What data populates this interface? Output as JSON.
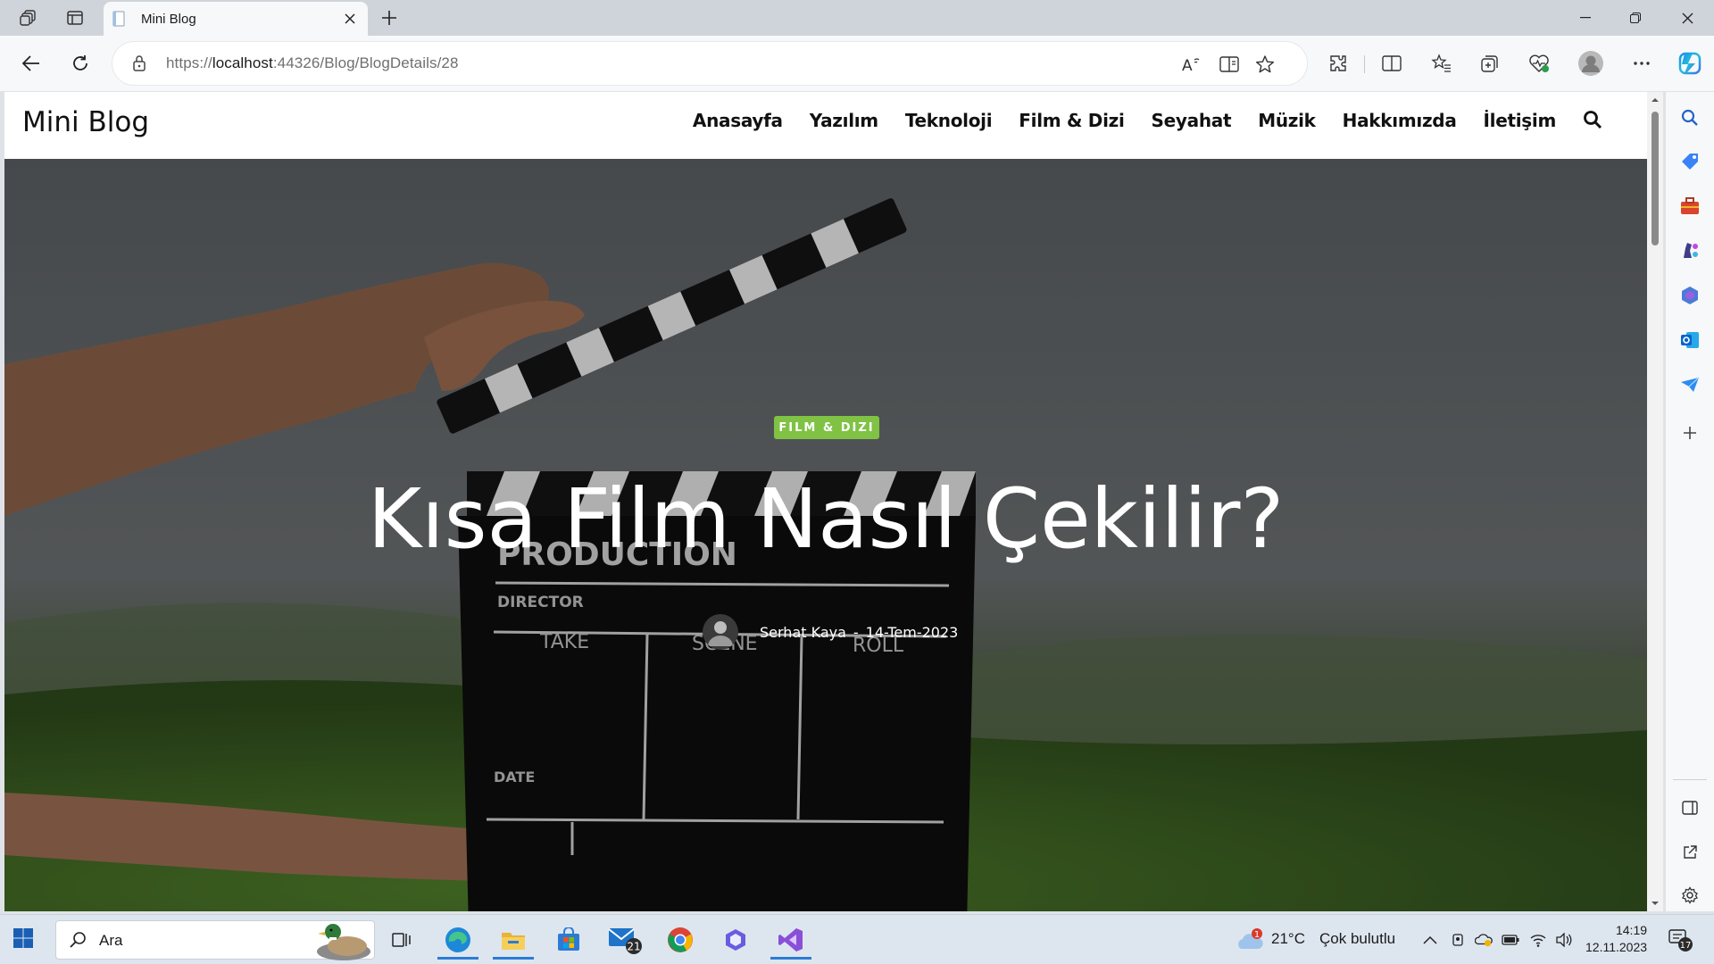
{
  "browser": {
    "tab_title": "Mini Blog",
    "url_prefix": "https://",
    "url_host": "localhost",
    "url_rest": ":44326/Blog/BlogDetails/28"
  },
  "site": {
    "brand": "Mini Blog",
    "nav": [
      "Anasayfa",
      "Yazılım",
      "Teknoloji",
      "Film & Dizi",
      "Seyahat",
      "Müzik",
      "Hakkımızda",
      "İletişim"
    ]
  },
  "post": {
    "category": "FILM & DIZI",
    "title": "Kısa Film Nasıl Çekilir?",
    "author": "Serhat Kaya",
    "separator": "-",
    "date": "14-Tem-2023"
  },
  "clapperboard": {
    "production": "PRODUCTION",
    "director": "DIRECTOR",
    "take": "TAKE",
    "scene": "SCENE",
    "roll": "ROLL",
    "date": "DATE"
  },
  "taskbar": {
    "search_placeholder": "Ara",
    "mail_badge": "21",
    "weather_temp": "21°C",
    "weather_desc": "Çok bulutlu",
    "weather_alert": "1",
    "time": "14:19",
    "date": "12.11.2023",
    "notif_count": "17"
  },
  "colors": {
    "badge": "#7fc244",
    "accent": "#2b7bd6"
  },
  "icons": [
    "workspaces-icon",
    "tab-actions-icon",
    "page-icon",
    "close-icon",
    "plus-icon",
    "minimize-icon",
    "restore-icon",
    "back-icon",
    "refresh-icon",
    "lock-icon",
    "read-aloud-icon",
    "immersive-reader-icon",
    "favorite-star-icon",
    "extensions-icon",
    "split-screen-icon",
    "favorites-icon",
    "collections-icon",
    "browser-essentials-icon",
    "profile-icon",
    "more-icon",
    "copilot-icon",
    "search-icon",
    "shopping-icon",
    "tools-icon",
    "games-icon",
    "m365-icon",
    "outlook-icon",
    "drop-icon",
    "add-icon",
    "sidebar-toggle-icon",
    "open-external-icon",
    "settings-icon",
    "windows-start-icon",
    "task-view-icon",
    "edge-icon",
    "file-explorer-icon",
    "store-icon",
    "mail-icon",
    "chrome-icon",
    "copilot-app-icon",
    "visual-studio-icon",
    "weather-icon",
    "chevron-up-icon",
    "meet-icon",
    "onedrive-icon",
    "battery-icon",
    "wifi-icon",
    "volume-icon",
    "notifications-icon"
  ]
}
